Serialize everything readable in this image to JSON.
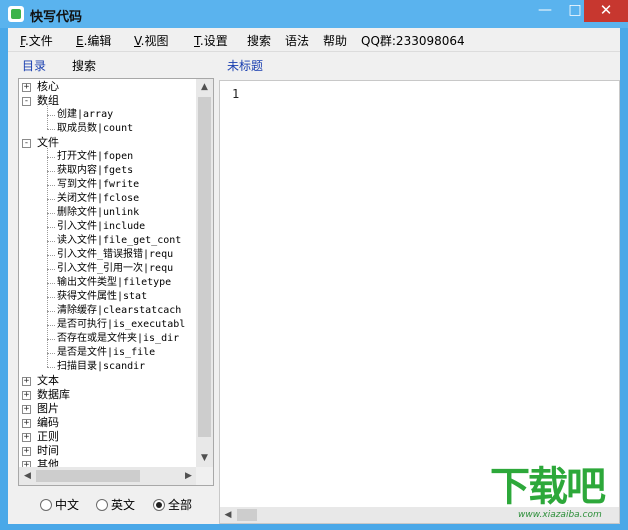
{
  "window": {
    "title": "快写代码",
    "controls": {
      "minimize": "—",
      "maximize": "□",
      "close": "✕"
    }
  },
  "menu": [
    {
      "key": "F",
      "rest": ".文件"
    },
    {
      "key": "E",
      "rest": ".编辑"
    },
    {
      "key": "V",
      "rest": ".视图"
    },
    {
      "key": "T",
      "rest": ".设置"
    },
    {
      "key": "",
      "rest": "搜索"
    },
    {
      "key": "",
      "rest": "语法"
    },
    {
      "key": "",
      "rest": "帮助"
    },
    {
      "key": "",
      "rest": "QQ群:233098064"
    }
  ],
  "left_tabs": {
    "directory": "目录",
    "search": "搜索"
  },
  "editor": {
    "title": "未标题",
    "line_number": "1"
  },
  "tree": [
    {
      "label": "核心",
      "level": 0,
      "expander": "+"
    },
    {
      "label": "数组",
      "level": 0,
      "expander": "-"
    },
    {
      "label": "创建|array",
      "level": 1
    },
    {
      "label": "取成员数|count",
      "level": 1
    },
    {
      "label": "文件",
      "level": 0,
      "expander": "-"
    },
    {
      "label": "打开文件|fopen",
      "level": 1
    },
    {
      "label": "获取内容|fgets",
      "level": 1
    },
    {
      "label": "写到文件|fwrite",
      "level": 1
    },
    {
      "label": "关闭文件|fclose",
      "level": 1
    },
    {
      "label": "删除文件|unlink",
      "level": 1
    },
    {
      "label": "引入文件|include",
      "level": 1
    },
    {
      "label": "读入文件|file_get_cont",
      "level": 1
    },
    {
      "label": "引入文件_错误报错|requ",
      "level": 1
    },
    {
      "label": "引入文件_引用一次|requ",
      "level": 1
    },
    {
      "label": "输出文件类型|filetype",
      "level": 1
    },
    {
      "label": "获得文件属性|stat",
      "level": 1
    },
    {
      "label": "清除缓存|clearstatcach",
      "level": 1
    },
    {
      "label": "是否可执行|is_executabl",
      "level": 1
    },
    {
      "label": "否存在或是文件夹|is_dir",
      "level": 1
    },
    {
      "label": "是否是文件|is_file",
      "level": 1
    },
    {
      "label": "扫描目录|scandir",
      "level": 1
    },
    {
      "label": "文本",
      "level": 0,
      "expander": "+"
    },
    {
      "label": "数据库",
      "level": 0,
      "expander": "+"
    },
    {
      "label": "图片",
      "level": 0,
      "expander": "+"
    },
    {
      "label": "编码",
      "level": 0,
      "expander": "+"
    },
    {
      "label": "正则",
      "level": 0,
      "expander": "+"
    },
    {
      "label": "时间",
      "level": 0,
      "expander": "+"
    },
    {
      "label": "其他",
      "level": 0,
      "expander": "+"
    }
  ],
  "scroll_arrows": {
    "up": "▲",
    "down": "▼",
    "left": "◀",
    "right": "▶"
  },
  "filter_radios": [
    {
      "label": "中文",
      "checked": false
    },
    {
      "label": "英文",
      "checked": false
    },
    {
      "label": "全部",
      "checked": true
    }
  ],
  "watermark": {
    "logo_text": "下载吧",
    "url": "www.xiazaiba.com"
  },
  "colors": {
    "titlebar": "#5ab3ee",
    "close_button": "#c7372f",
    "link_blue": "#1a3fb0",
    "watermark_green": "#2da83a"
  }
}
